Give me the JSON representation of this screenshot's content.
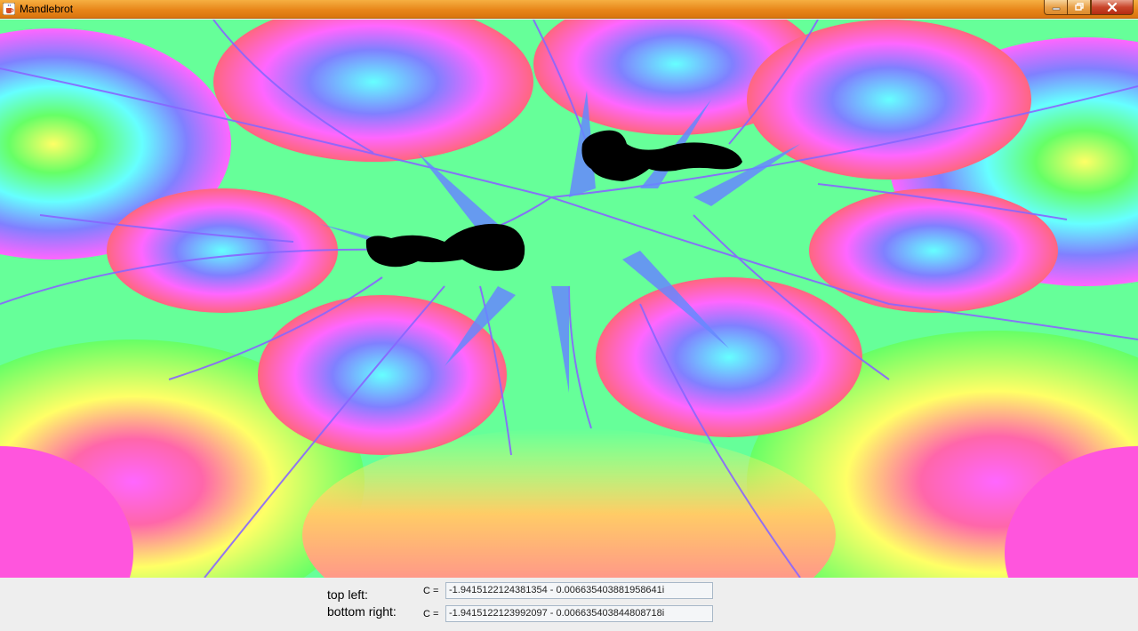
{
  "window": {
    "title": "Mandlebrot",
    "icon": "java-cup-icon",
    "controls": {
      "minimize": "minimize-icon",
      "maximize": "restore-icon",
      "close": "close-icon"
    }
  },
  "fractal_view": {
    "description_colors": [
      "#ff4ddb",
      "#ffff4d",
      "#4dff4d",
      "#4dffff",
      "#6b6bff",
      "#ff4dff"
    ]
  },
  "coordinates": {
    "top_left_label": "top left:",
    "bottom_right_label": "bottom right:",
    "c_label": "C =",
    "top_left_value": "-1.9415122124381354 - 0.006635403881958641i",
    "bottom_right_value": "-1.9415122123992097 - 0.006635403844808718i"
  }
}
